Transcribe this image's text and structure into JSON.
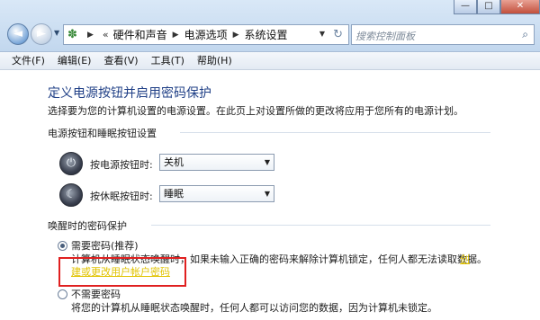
{
  "window": {
    "minimize": "—",
    "maximize": "□",
    "close": "✕"
  },
  "nav": {
    "back_icon": "back-arrow",
    "forward_icon": "forward-arrow"
  },
  "address": {
    "icon": "control-panel-icon",
    "chevrons": "«",
    "crumbs": [
      "硬件和声音",
      "电源选项",
      "系统设置"
    ]
  },
  "search": {
    "placeholder": "搜索控制面板"
  },
  "menu": [
    "文件(F)",
    "编辑(E)",
    "查看(V)",
    "工具(T)",
    "帮助(H)"
  ],
  "page": {
    "title": "定义电源按钮并启用密码保护",
    "description": "选择要为您的计算机设置的电源设置。在此页上对设置所做的更改将应用于您所有的电源计划。"
  },
  "buttons_section": {
    "heading": "电源按钮和睡眠按钮设置",
    "power_label": "按电源按钮时:",
    "power_value": "关机",
    "sleep_label": "按休眠按钮时:",
    "sleep_value": "睡眠"
  },
  "password_section": {
    "heading": "唤醒时的密码保护",
    "require_label": "需要密码(推荐)",
    "require_desc": "计算机从睡眠状态唤醒时，如果未输入正确的密码来解除计算机锁定，任何人都无法读取数据。",
    "link_text_1": "创",
    "link_text_2": "建或更改用户帐户密码",
    "no_require_label": "不需要密码",
    "no_require_desc": "将您的计算机从睡眠状态唤醒时，任何人都可以访问您的数据，因为计算机未锁定。"
  },
  "colors": {
    "title_blue": "#1f3f86",
    "link_yellow": "#e1c300",
    "highlight_red": "#e02020"
  }
}
